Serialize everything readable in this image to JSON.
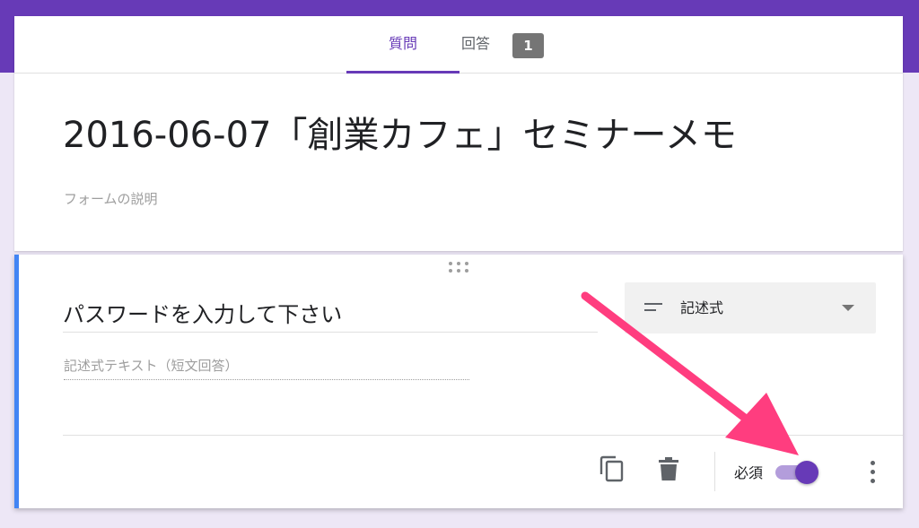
{
  "tabs": {
    "questions_label": "質問",
    "responses_label": "回答",
    "responses_count": "1"
  },
  "form": {
    "title": "2016-06-07「創業カフェ」セミナーメモ",
    "description_placeholder": "フォームの説明"
  },
  "question": {
    "title": "パスワードを入力して下さい",
    "type_label": "記述式",
    "answer_placeholder": "記述式テキスト（短文回答）",
    "required_label": "必須",
    "required_on": true
  },
  "colors": {
    "brand": "#673ab7",
    "accent_bar": "#4285f4",
    "annotation_arrow": "#ff3d7f",
    "page_background": "#ede7f6"
  },
  "icons": {
    "drag": "drag-handle-icon",
    "short_answer": "short-text-icon",
    "dropdown": "caret-down-icon",
    "duplicate": "copy-icon",
    "delete": "trash-icon",
    "more": "more-vert-icon"
  }
}
